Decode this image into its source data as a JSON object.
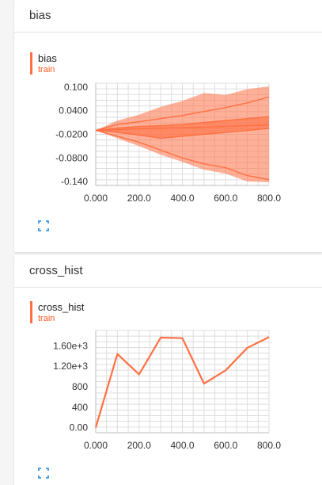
{
  "cards": [
    {
      "title": "bias",
      "series_name": "bias",
      "run": "train",
      "y_ticks": [
        "0.100",
        "0.0400",
        "-0.0200",
        "-0.0800",
        "-0.140"
      ],
      "x_ticks": [
        "0.000",
        "200.0",
        "400.0",
        "600.0",
        "800.0"
      ]
    },
    {
      "title": "cross_hist",
      "series_name": "cross_hist",
      "run": "train",
      "y_ticks": [
        "1.60e+3",
        "1.20e+3",
        "800",
        "400",
        "0.00"
      ],
      "x_ticks": [
        "0.000",
        "200.0",
        "400.0",
        "600.0",
        "800.0"
      ]
    }
  ],
  "accent_color": "#ff7043",
  "icons": {
    "expand": "expand-icon"
  },
  "chart_data": [
    {
      "type": "area",
      "title": "bias",
      "xlim": [
        0,
        800
      ],
      "ylim": [
        -0.15,
        0.11
      ],
      "x": [
        0,
        100,
        200,
        300,
        400,
        500,
        600,
        700,
        800
      ],
      "series": [
        {
          "name": "train",
          "values": [
            -0.01,
            0.005,
            0.012,
            0.02,
            0.028,
            0.038,
            0.048,
            0.06,
            0.075
          ]
        },
        {
          "name": "train",
          "values": [
            -0.01,
            -0.004,
            0.0,
            0.002,
            0.005,
            0.01,
            0.015,
            0.02,
            0.025
          ]
        },
        {
          "name": "train",
          "values": [
            -0.01,
            -0.008,
            -0.006,
            -0.004,
            -0.003,
            -0.002,
            0.0,
            0.002,
            0.004
          ]
        },
        {
          "name": "train",
          "values": [
            -0.01,
            -0.015,
            -0.022,
            -0.03,
            -0.025,
            -0.02,
            -0.015,
            -0.01,
            -0.005
          ]
        },
        {
          "name": "train",
          "values": [
            -0.01,
            -0.025,
            -0.04,
            -0.06,
            -0.08,
            -0.095,
            -0.105,
            -0.125,
            -0.135
          ]
        }
      ],
      "band_upper": [
        -0.01,
        0.015,
        0.03,
        0.05,
        0.065,
        0.085,
        0.08,
        0.095,
        0.102
      ],
      "band_lower": [
        -0.01,
        -0.03,
        -0.05,
        -0.072,
        -0.09,
        -0.11,
        -0.12,
        -0.14,
        -0.142
      ],
      "grid": true
    },
    {
      "type": "line",
      "title": "cross_hist",
      "xlim": [
        0,
        800
      ],
      "ylim": [
        -100,
        1900
      ],
      "x": [
        0,
        100,
        200,
        300,
        400,
        500,
        600,
        700,
        800
      ],
      "series": [
        {
          "name": "train",
          "values": [
            0,
            1440,
            1040,
            1760,
            1750,
            860,
            1120,
            1560,
            1770
          ]
        }
      ],
      "grid": true
    }
  ]
}
